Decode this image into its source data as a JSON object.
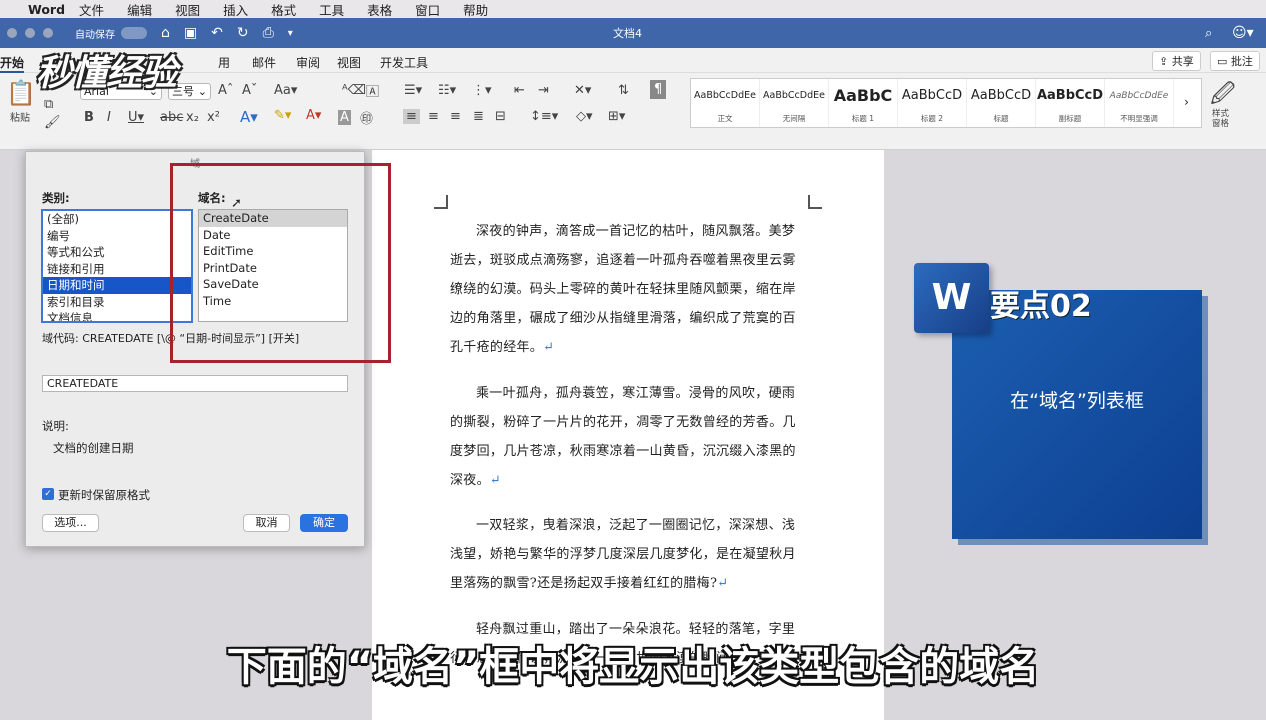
{
  "menubar": {
    "app": "Word",
    "items": [
      "文件",
      "编辑",
      "视图",
      "插入",
      "格式",
      "工具",
      "表格",
      "窗口",
      "帮助"
    ]
  },
  "titlebar": {
    "autosave": "自动保存",
    "doc_title": "文档4"
  },
  "tabs": [
    "开始",
    "用",
    "邮件",
    "审阅",
    "视图",
    "开发工具"
  ],
  "share_label": "共享",
  "comment_label": "批注",
  "ribbon": {
    "paste_label": "粘贴",
    "font_name": "Arial",
    "font_size": "三号",
    "styles": [
      {
        "preview": "AaBbCcDdEe",
        "name": "正文"
      },
      {
        "preview": "AaBbCcDdEe",
        "name": "无间隔"
      },
      {
        "preview": "AaBbC",
        "name": "标题 1"
      },
      {
        "preview": "AaBbCcD",
        "name": "标题 2"
      },
      {
        "preview": "AaBbCcD",
        "name": "标题"
      },
      {
        "preview": "AaBbCcD",
        "name": "副标题"
      },
      {
        "preview": "AaBbCcDdEe",
        "name": "不明显强调"
      }
    ],
    "style_pane": "样式窗格"
  },
  "dialog": {
    "title": "域",
    "category_label": "类别:",
    "categories": [
      "(全部)",
      "编号",
      "等式和公式",
      "链接和引用",
      "日期和时间",
      "索引和目录",
      "文档信息"
    ],
    "selected_category": 4,
    "fieldname_label": "域名:",
    "fieldnames": [
      "CreateDate",
      "Date",
      "EditTime",
      "PrintDate",
      "SaveDate",
      "Time"
    ],
    "selected_fieldname": 0,
    "field_code_label": "域代码:  CREATEDATE [\\@ “日期-时间显示”] [开关]",
    "field_code_value": "CREATEDATE",
    "description_label": "说明:",
    "description": "文档的创建日期",
    "preserve_format": "更新时保留原格式",
    "options_button": "选项...",
    "cancel_button": "取消",
    "ok_button": "确定"
  },
  "document": {
    "paragraphs": [
      "深夜的钟声，滴答成一首记忆的枯叶，随风飘落。美梦逝去，斑驳成点滴殇寥，追逐着一叶孤舟吞噬着黑夜里云雾缭绕的幻漠。码头上零碎的黄叶在轻抹里随风颤栗，缩在岸边的角落里，碾成了细沙从指缝里滑落，编织成了荒寞的百孔千疮的经年。",
      "乘一叶孤舟，孤舟蓑笠，寒江薄雪。浸骨的风吹，硬雨的撕裂，粉碎了一片片的花开，凋零了无数曾经的芳香。几度梦回，几片苍凉，秋雨寒凉着一山黄昏，沉沉缀入漆黑的深夜。",
      "一双轻浆，曳着深浪，泛起了一圈圈记忆，深深想、浅浅望，娇艳与繁华的浮梦几度深层几度梦化，是在凝望秋月里落殇的飘雪?还是扬起双手接着红红的腊梅?",
      "轻舟飘过重山，踏出了一朵朵浪花。轻轻的落笔，字里行尽思念，传说，流淌着一生三世的落漠的瞬间。"
    ],
    "return_mark": "↵"
  },
  "overlay": {
    "watermark": "秒懂经验",
    "point_title": "要点02",
    "point_text": "在“域名”列表框",
    "subtitle": "下面的“域名”框中将显示出该类型包含的域名"
  }
}
